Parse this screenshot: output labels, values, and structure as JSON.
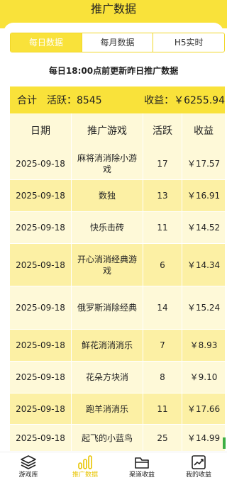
{
  "header": {
    "title": "推广数据"
  },
  "tabs": [
    {
      "label": "每日数据",
      "active": true
    },
    {
      "label": "每月数据",
      "active": false
    },
    {
      "label": "H5实时",
      "active": false
    }
  ],
  "notice": "每日18:00点前更新昨日推广数据",
  "summary": {
    "label": "合计",
    "active_label": "活跃：",
    "active_value": "8545",
    "income_label": "收益：",
    "income_value": "￥6255.94"
  },
  "table": {
    "columns": [
      "日期",
      "推广游戏",
      "活跃",
      "收益"
    ],
    "rows": [
      {
        "date": "2025-09-18",
        "game": "麻将消消除小游戏",
        "active": "17",
        "income": "￥17.57"
      },
      {
        "date": "2025-09-18",
        "game": "数独",
        "active": "13",
        "income": "￥16.91"
      },
      {
        "date": "2025-09-18",
        "game": "快乐击砖",
        "active": "11",
        "income": "￥14.52"
      },
      {
        "date": "2025-09-18",
        "game": "开心消消经典游戏",
        "active": "6",
        "income": "￥14.34"
      },
      {
        "date": "2025-09-18",
        "game": "俄罗斯消除经典",
        "active": "14",
        "income": "￥15.24"
      },
      {
        "date": "2025-09-18",
        "game": "鲜花消消消乐",
        "active": "7",
        "income": "￥8.93"
      },
      {
        "date": "2025-09-18",
        "game": "花朵方块消",
        "active": "8",
        "income": "￥9.10"
      },
      {
        "date": "2025-09-18",
        "game": "跑羊消消乐",
        "active": "11",
        "income": "￥17.66"
      },
      {
        "date": "2025-09-18",
        "game": "起飞的小蓝鸟",
        "active": "25",
        "income": "￥14.99"
      }
    ]
  },
  "nav": [
    {
      "label": "游戏库",
      "icon": "layers-icon",
      "active": false
    },
    {
      "label": "推广数据",
      "icon": "bar-chart-icon",
      "active": true
    },
    {
      "label": "渠道收益",
      "icon": "folder-icon",
      "active": false
    },
    {
      "label": "我的收益",
      "icon": "trend-chart-icon",
      "active": false
    }
  ],
  "colors": {
    "accent": "#f9e23a",
    "row_light": "#fef9d8",
    "row_dark": "#fcf0a4",
    "nav_active": "#e8c400"
  }
}
